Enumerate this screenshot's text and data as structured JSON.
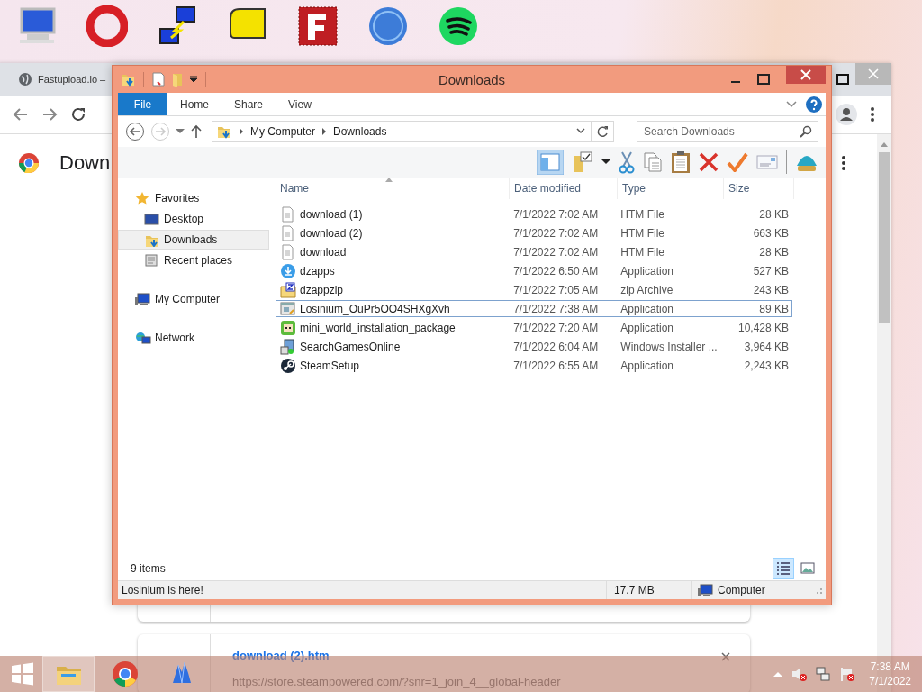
{
  "browser": {
    "tab_title": "Fastupload.io –",
    "page_heading": "Down",
    "downloads": [
      {
        "name": "download (2).htm",
        "url": "https://store.steampowered.com/?snr=1_join_4__global-header"
      }
    ]
  },
  "explorer": {
    "title": "Downloads",
    "ribbon_tabs": [
      {
        "label": "File",
        "kind": "file"
      },
      {
        "label": "Home",
        "kind": "tab"
      },
      {
        "label": "Share",
        "kind": "tab"
      },
      {
        "label": "View",
        "kind": "tab"
      }
    ],
    "breadcrumb": [
      "My Computer",
      "Downloads"
    ],
    "search": {
      "placeholder": "Search Downloads"
    },
    "nav": [
      {
        "label": "Favorites",
        "kind": "star",
        "selected": false,
        "children": [
          {
            "label": "Desktop",
            "kind": "desktop",
            "selected": false
          },
          {
            "label": "Downloads",
            "kind": "downloads",
            "selected": true
          },
          {
            "label": "Recent places",
            "kind": "recent",
            "selected": false
          }
        ]
      },
      {
        "label": "My Computer",
        "kind": "computer",
        "selected": false
      },
      {
        "label": "Network",
        "kind": "network",
        "selected": false
      }
    ],
    "columns": [
      "Name",
      "Date modified",
      "Type",
      "Size"
    ],
    "rows": [
      {
        "name": "download (1)",
        "date": "7/1/2022 7:02 AM",
        "type": "HTM File",
        "size": "28 KB",
        "kind": "htm",
        "selected": false
      },
      {
        "name": "download (2)",
        "date": "7/1/2022 7:02 AM",
        "type": "HTM File",
        "size": "663 KB",
        "kind": "htm",
        "selected": false
      },
      {
        "name": "download",
        "date": "7/1/2022 7:02 AM",
        "type": "HTM File",
        "size": "28 KB",
        "kind": "htm",
        "selected": false
      },
      {
        "name": "dzapps",
        "date": "7/1/2022 6:50 AM",
        "type": "Application",
        "size": "527 KB",
        "kind": "dlapp",
        "selected": false
      },
      {
        "name": "dzappzip",
        "date": "7/1/2022 7:05 AM",
        "type": "zip Archive",
        "size": "243 KB",
        "kind": "zip",
        "selected": false
      },
      {
        "name": "Losinium_OuPr5OO4SHXgXvh",
        "date": "7/1/2022 7:38 AM",
        "type": "Application",
        "size": "89 KB",
        "kind": "app",
        "selected": true
      },
      {
        "name": "mini_world_installation_package",
        "date": "7/1/2022 7:20 AM",
        "type": "Application",
        "size": "10,428 KB",
        "kind": "game",
        "selected": false
      },
      {
        "name": "SearchGamesOnline",
        "date": "7/1/2022 6:04 AM",
        "type": "Windows Installer ...",
        "size": "3,964 KB",
        "kind": "installer",
        "selected": false
      },
      {
        "name": "SteamSetup",
        "date": "7/1/2022 6:55 AM",
        "type": "Application",
        "size": "2,243 KB",
        "kind": "steam",
        "selected": false
      }
    ],
    "item_count": "9 items",
    "view_buttons": [
      {
        "kind": "details",
        "selected": true
      },
      {
        "kind": "large",
        "selected": false
      }
    ],
    "status_text": "Losinium is here!",
    "status_size": "17.7 MB",
    "status_location": "Computer"
  },
  "taskbar": {
    "apps": [
      {
        "kind": "folder",
        "selected": true
      },
      {
        "kind": "chrome",
        "selected": false
      },
      {
        "kind": "crystal",
        "selected": false
      }
    ],
    "time": "7:38 AM",
    "date": "7/1/2022"
  }
}
